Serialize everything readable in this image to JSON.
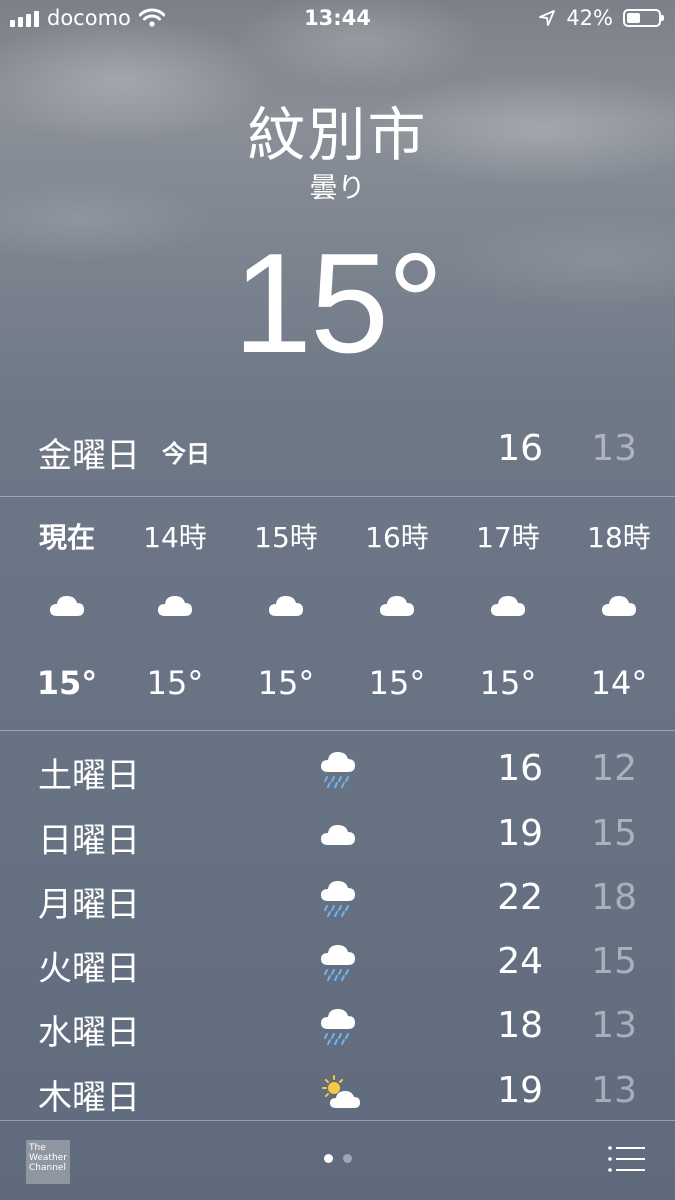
{
  "status_bar": {
    "carrier": "docomo",
    "time": "13:44",
    "battery": "42%",
    "battery_level": 0.42
  },
  "location": {
    "city": "紋別市",
    "condition": "曇り",
    "temperature": "15°"
  },
  "today": {
    "day": "金曜日",
    "tag": "今日",
    "high": "16",
    "low": "13"
  },
  "hourly": [
    {
      "label": "現在",
      "icon": "cloud-icon",
      "temp": "15°",
      "current": true
    },
    {
      "label": "14時",
      "icon": "cloud-icon",
      "temp": "15°"
    },
    {
      "label": "15時",
      "icon": "cloud-icon",
      "temp": "15°"
    },
    {
      "label": "16時",
      "icon": "cloud-icon",
      "temp": "15°"
    },
    {
      "label": "17時",
      "icon": "cloud-icon",
      "temp": "15°"
    },
    {
      "label": "18時",
      "icon": "cloud-icon",
      "temp": "14°"
    }
  ],
  "daily": [
    {
      "day": "土曜日",
      "icon": "rain-icon",
      "high": "16",
      "low": "12"
    },
    {
      "day": "日曜日",
      "icon": "cloud-icon",
      "high": "19",
      "low": "15"
    },
    {
      "day": "月曜日",
      "icon": "rain-icon",
      "high": "22",
      "low": "18"
    },
    {
      "day": "火曜日",
      "icon": "rain-icon",
      "high": "24",
      "low": "15"
    },
    {
      "day": "水曜日",
      "icon": "rain-icon",
      "high": "18",
      "low": "13"
    },
    {
      "day": "木曜日",
      "icon": "partly-sunny-icon",
      "high": "19",
      "low": "13"
    }
  ],
  "footer": {
    "logo_text": "The Weather Channel",
    "page_count": 2,
    "active_page": 1
  },
  "colors": {
    "low_temp": "#ffffff73",
    "divider": "#ffffff59",
    "sun": "#f6c844",
    "rain": "#6db4f2"
  }
}
